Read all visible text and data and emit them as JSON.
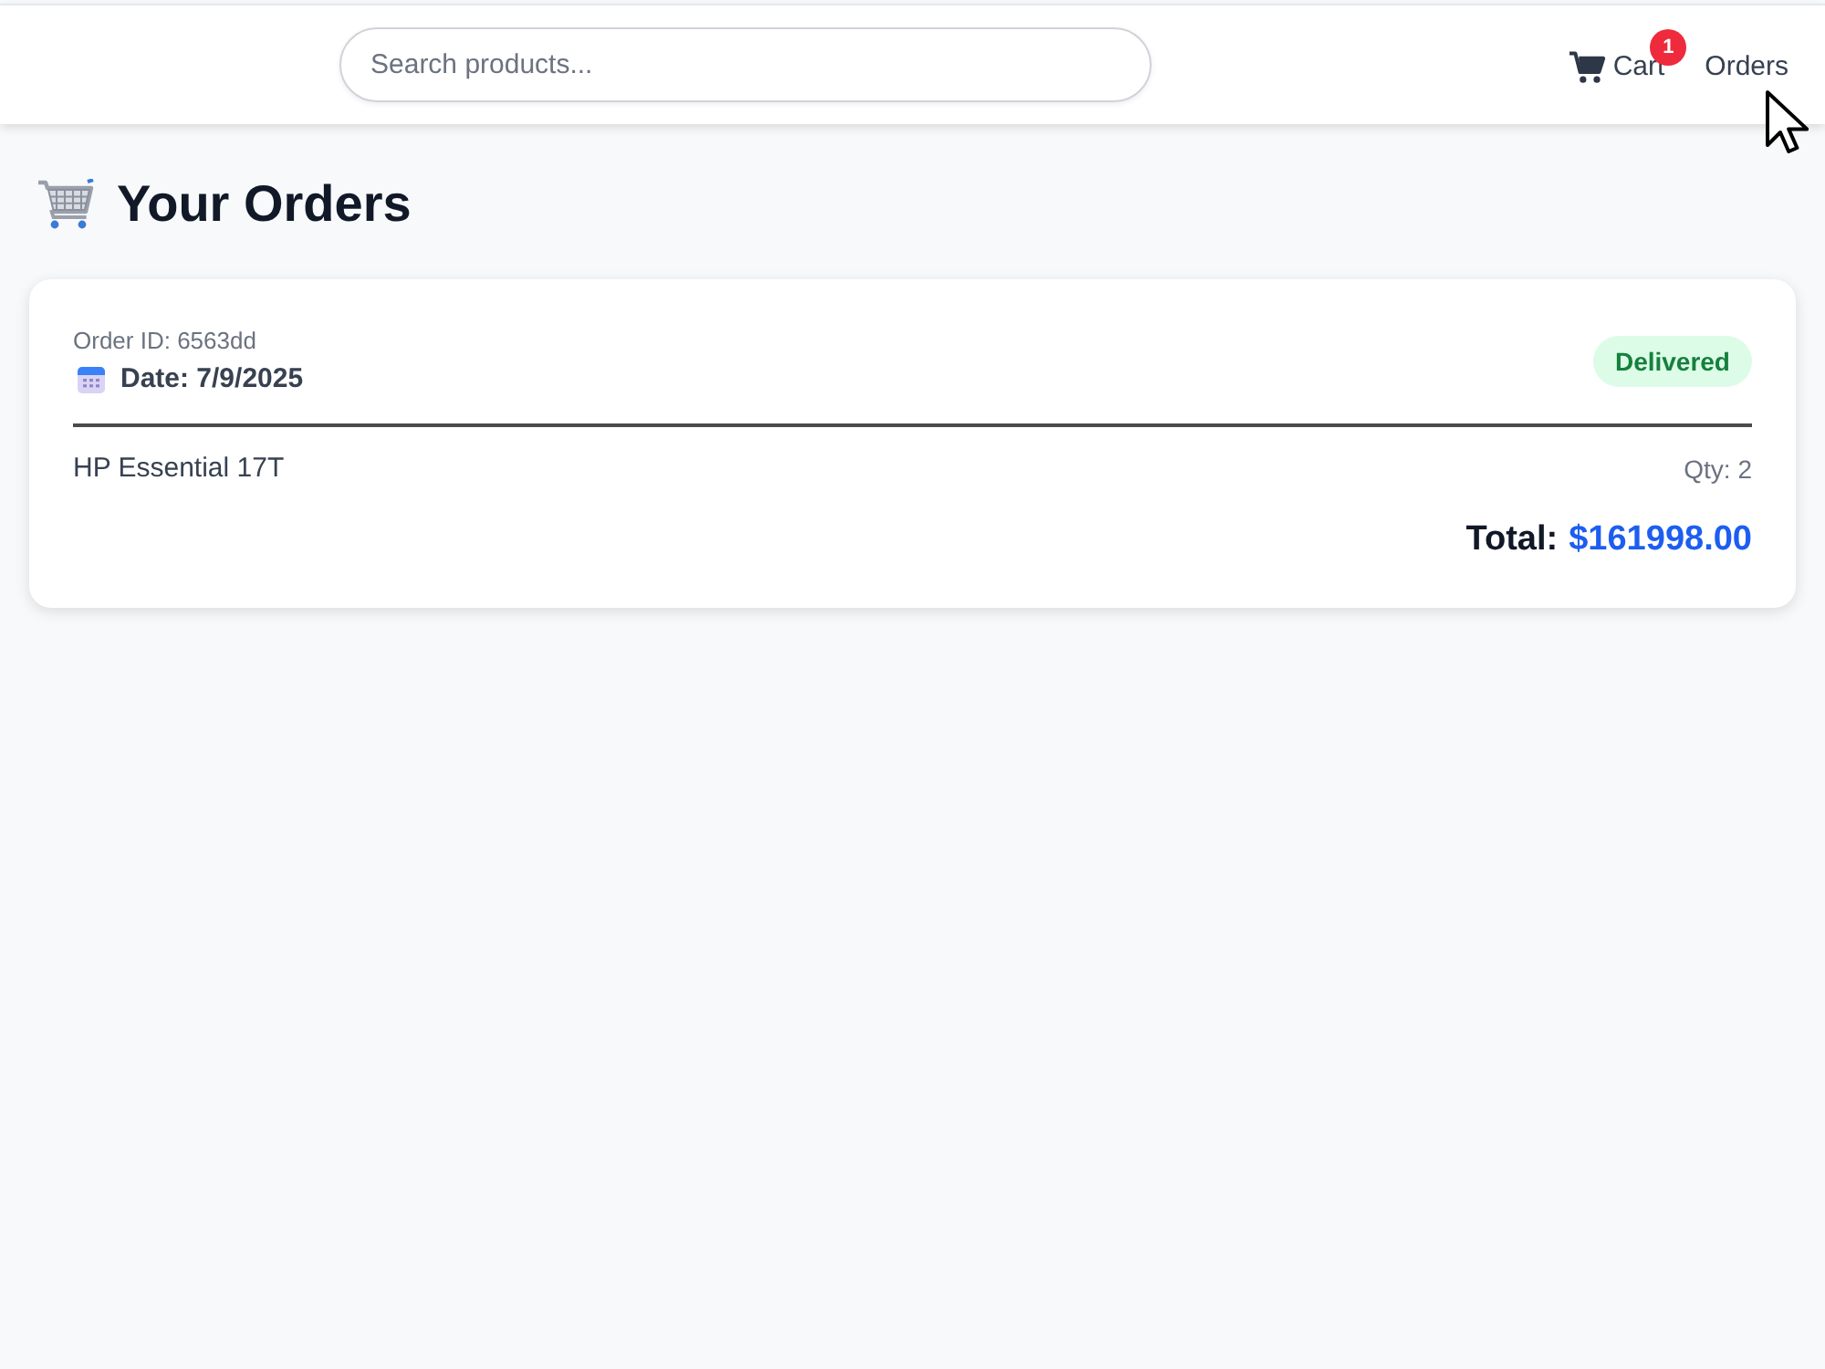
{
  "header": {
    "search": {
      "placeholder": "Search products..."
    },
    "nav": [
      {
        "kind": "cart",
        "label": "Cart",
        "badge": "1"
      },
      {
        "kind": "link",
        "label": "Orders"
      }
    ]
  },
  "page": {
    "title": "Your Orders"
  },
  "orders": [
    {
      "id_label": "Order ID: 6563dd",
      "date": "Date: 7/9/2025",
      "status": "Delivered",
      "items": [
        {
          "name": "HP Essential 17T",
          "qty": "Qty: 2"
        }
      ],
      "total_label": "Total:",
      "total": "$161998.00"
    }
  ]
}
